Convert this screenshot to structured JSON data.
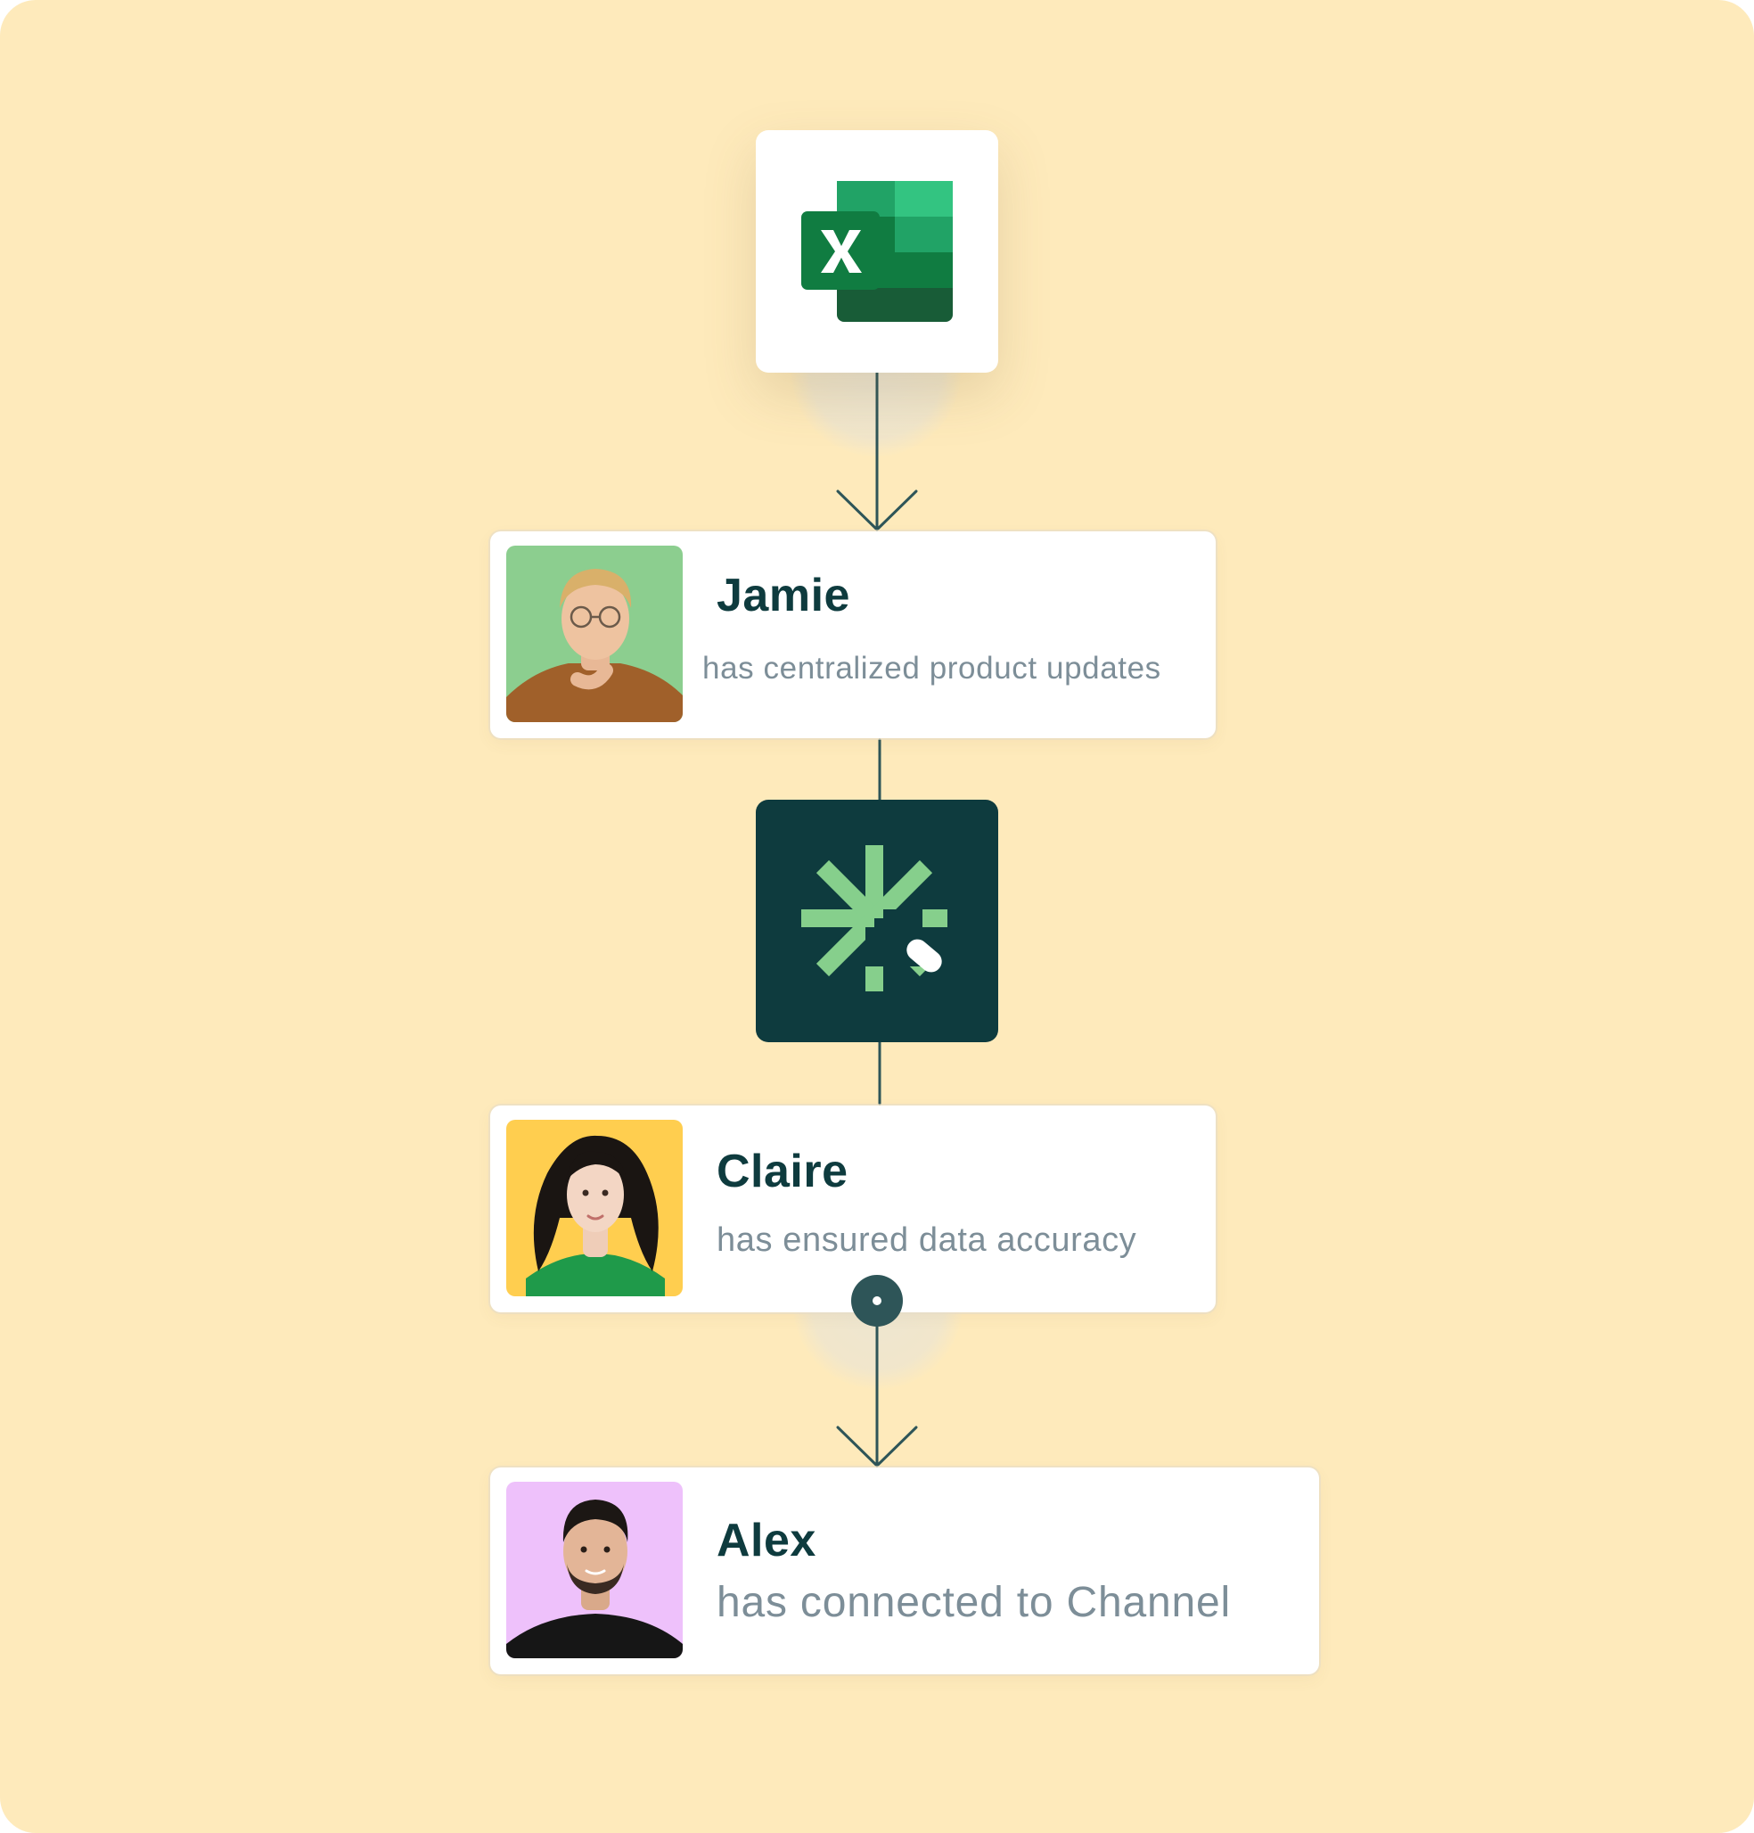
{
  "colors": {
    "background": "#FEEABB",
    "primary_dark": "#0E3B3E",
    "accent_green": "#86CF8C",
    "muted_text": "#7D8E98",
    "excel_green": "#107C41"
  },
  "nodes": {
    "source": {
      "icon": "microsoft-excel-icon"
    },
    "integration": {
      "icon": "channel-asterisk-icon"
    }
  },
  "activities": [
    {
      "name": "Jamie",
      "description": "has centralized product updates",
      "avatar_bg": "#8CCE8F"
    },
    {
      "name": "Claire",
      "description": "has ensured data accuracy",
      "avatar_bg": "#FFCE4F"
    },
    {
      "name": "Alex",
      "description": "has connected to Channel",
      "avatar_bg": "#EEC1FB"
    }
  ]
}
